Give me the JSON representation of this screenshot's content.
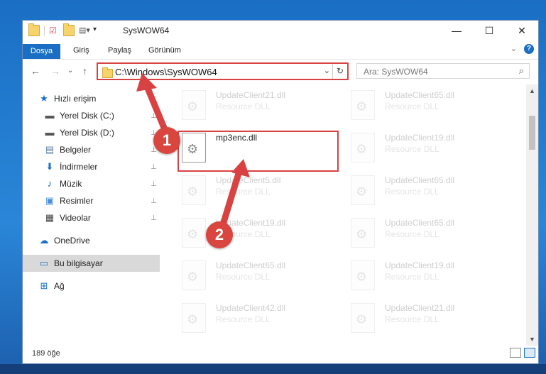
{
  "window": {
    "title": "SysWOW64",
    "controls": {
      "minimize": "—",
      "maximize": "☐",
      "close": "✕"
    }
  },
  "ribbon": {
    "tabs": [
      "Dosya",
      "Giriş",
      "Paylaş",
      "Görünüm"
    ],
    "expand": "⌄",
    "help": "?"
  },
  "navigation": {
    "back": "←",
    "forward": "→",
    "recent": "⌄",
    "up": "↑",
    "address": "C:\\Windows\\SysWOW64",
    "address_dropdown": "⌄",
    "refresh": "↻",
    "search_placeholder": "Ara: SysWOW64",
    "search_icon": "⌕"
  },
  "sidebar": {
    "items": [
      {
        "label": "Hızlı erişim",
        "icon": "star-icon",
        "glyph": "★",
        "color": "#1a6fc4",
        "pinned": false
      },
      {
        "label": "Yerel Disk (C:)",
        "icon": "drive-icon",
        "glyph": "▬",
        "color": "#555555",
        "pinned": true
      },
      {
        "label": "Yerel Disk (D:)",
        "icon": "drive-icon",
        "glyph": "▬",
        "color": "#555555",
        "pinned": true
      },
      {
        "label": "Belgeler",
        "icon": "documents-icon",
        "glyph": "▤",
        "color": "#5b7fa8",
        "pinned": true
      },
      {
        "label": "İndirmeler",
        "icon": "download-icon",
        "glyph": "⬇",
        "color": "#1a6fc4",
        "pinned": true
      },
      {
        "label": "Müzik",
        "icon": "music-icon",
        "glyph": "♪",
        "color": "#1a6fc4",
        "pinned": true
      },
      {
        "label": "Resimler",
        "icon": "pictures-icon",
        "glyph": "▣",
        "color": "#4a8fd8",
        "pinned": true
      },
      {
        "label": "Videolar",
        "icon": "videos-icon",
        "glyph": "▦",
        "color": "#444444",
        "pinned": true
      },
      {
        "label": "OneDrive",
        "icon": "cloud-icon",
        "glyph": "☁",
        "color": "#1a6fc4",
        "pinned": false
      },
      {
        "label": "Bu bilgisayar",
        "icon": "computer-icon",
        "glyph": "▭",
        "color": "#1a6fc4",
        "pinned": false,
        "selected": true
      },
      {
        "label": "Ağ",
        "icon": "network-icon",
        "glyph": "⊞",
        "color": "#1a6fc4",
        "pinned": false
      }
    ],
    "pin_glyph": "📌"
  },
  "files": {
    "left_column": [
      {
        "name": "UpdateClient21.dll",
        "type": "Resource DLL",
        "faded": true
      },
      {
        "name": "mp3enc.dll",
        "type": "",
        "faded": false,
        "highlighted": true
      },
      {
        "name": "UpdateClient5.dll",
        "type": "Resource DLL",
        "faded": true
      },
      {
        "name": "UpdateClient19.dll",
        "type": "Resource DLL",
        "faded": true
      },
      {
        "name": "UpdateClient65.dll",
        "type": "Resource DLL",
        "faded": true
      },
      {
        "name": "UpdateClient42.dll",
        "type": "Resource DLL",
        "faded": true
      }
    ],
    "right_column": [
      {
        "name": "UpdateClient65.dll",
        "type": "Resource DLL",
        "faded": true
      },
      {
        "name": "UpdateClient19.dll",
        "type": "Resource DLL",
        "faded": true
      },
      {
        "name": "UpdateClient65.dll",
        "type": "Resource DLL",
        "faded": true
      },
      {
        "name": "UpdateClient65.dll",
        "type": "Resource DLL",
        "faded": true
      },
      {
        "name": "UpdateClient19.dll",
        "type": "Resource DLL",
        "faded": true
      },
      {
        "name": "UpdateClient21.dll",
        "type": "Resource DLL",
        "faded": true
      }
    ]
  },
  "status": {
    "count": "189 öğe"
  },
  "annotations": {
    "badge_1": "1",
    "badge_2": "2",
    "color": "#d94242"
  }
}
